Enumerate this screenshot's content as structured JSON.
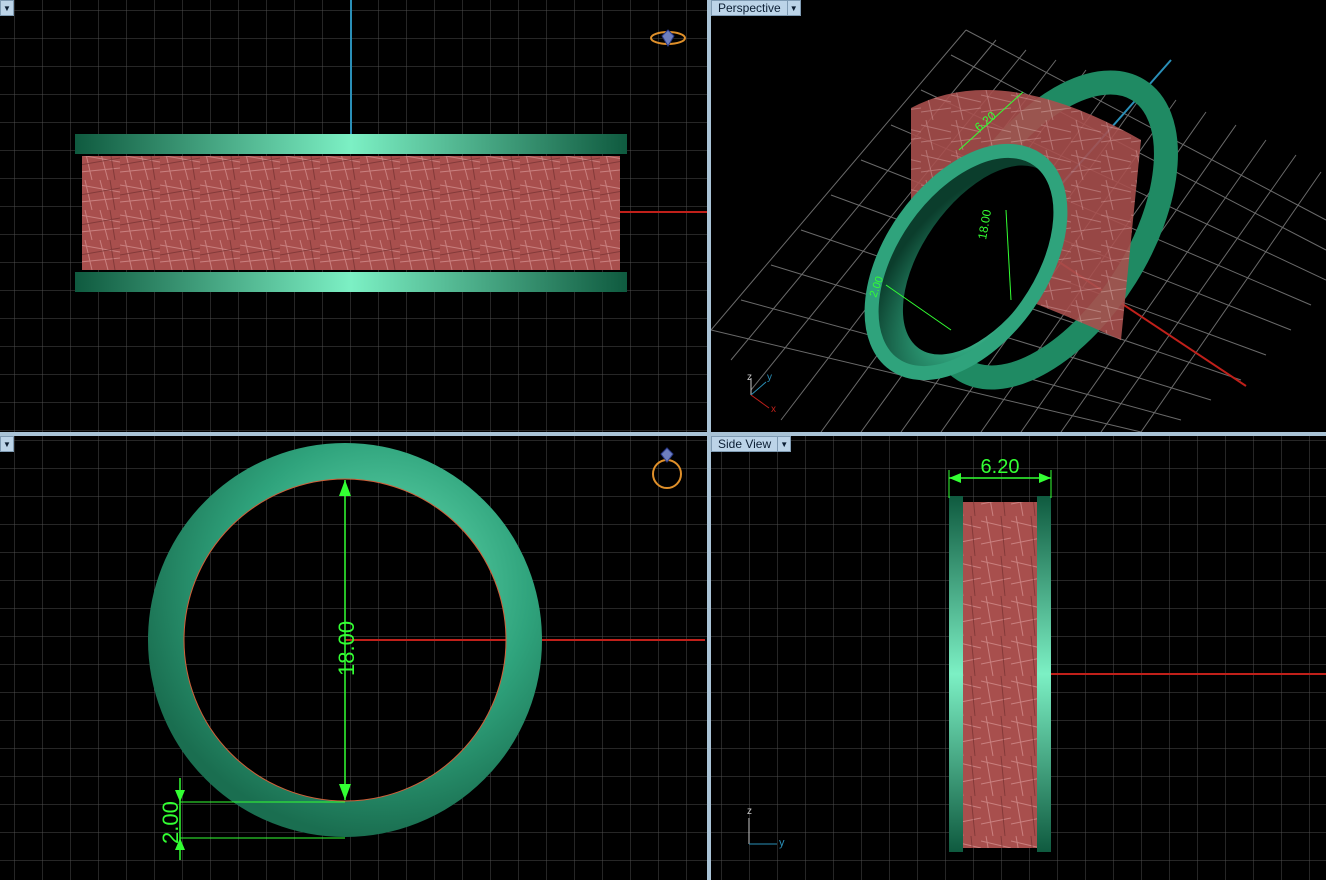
{
  "viewports": {
    "top": {
      "label": ""
    },
    "perspective": {
      "label": "Perspective"
    },
    "front": {
      "label": ""
    },
    "side": {
      "label": "Side View"
    }
  },
  "dimensions": {
    "width": "6.20",
    "inner_diameter": "18.00",
    "thickness": "2.00"
  },
  "axes": {
    "x": "x",
    "y": "y",
    "z": "z"
  },
  "icons": {
    "menu": "chevron-down-icon",
    "view_cube": "ring-icon"
  },
  "colors": {
    "band_green": "#2fa37c",
    "texture_red": "#b85c58",
    "dimension_green": "#33ff33",
    "axis_red": "#c0201a",
    "axis_blue": "#2a8fb8",
    "grid": "#5a5a5a"
  }
}
